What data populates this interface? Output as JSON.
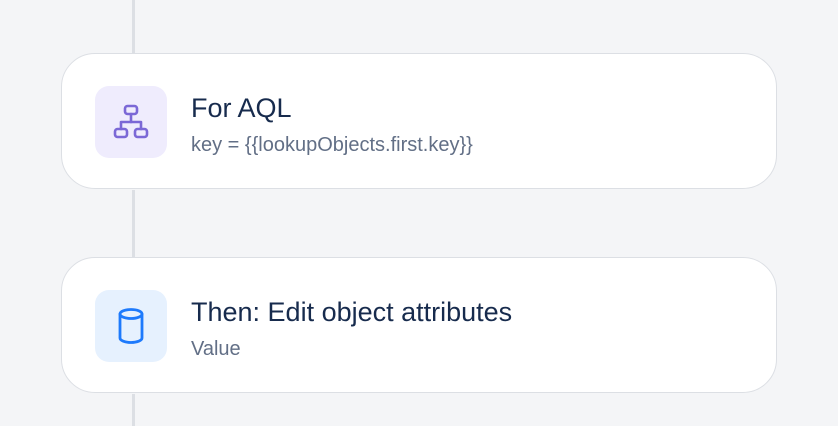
{
  "steps": [
    {
      "title": "For AQL",
      "subtitle": "key = {{lookupObjects.first.key}}",
      "icon": "hierarchy-icon",
      "icon_color": "#7b68d6",
      "icon_bg": "#efecfd"
    },
    {
      "title": "Then: Edit object attributes",
      "subtitle": "Value",
      "icon": "database-icon",
      "icon_color": "#1d7afc",
      "icon_bg": "#e6f1fe"
    }
  ],
  "colors": {
    "background": "#f4f5f7",
    "card_border": "#dcdfe4",
    "title_text": "#172b4d",
    "subtitle_text": "#626f86"
  }
}
